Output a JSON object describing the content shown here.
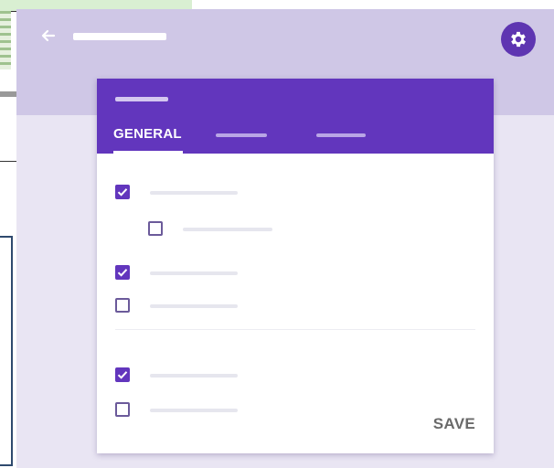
{
  "dialog": {
    "tabs": [
      {
        "label": "GENERAL",
        "active": true
      },
      {
        "label": "",
        "active": false
      },
      {
        "label": "",
        "active": false
      }
    ],
    "options": [
      {
        "checked": true
      },
      {
        "checked": false,
        "indented": true
      },
      {
        "checked": true
      },
      {
        "checked": false
      },
      {
        "checked": true
      },
      {
        "checked": false
      }
    ],
    "save_label": "SAVE"
  },
  "icons": {
    "back": "arrow-left-icon",
    "settings": "gear-icon"
  },
  "colors": {
    "accent": "#6236bd",
    "app_bar": "#cfc7e6",
    "background": "#e9e5f3",
    "settings_button": "#5e35b1"
  }
}
